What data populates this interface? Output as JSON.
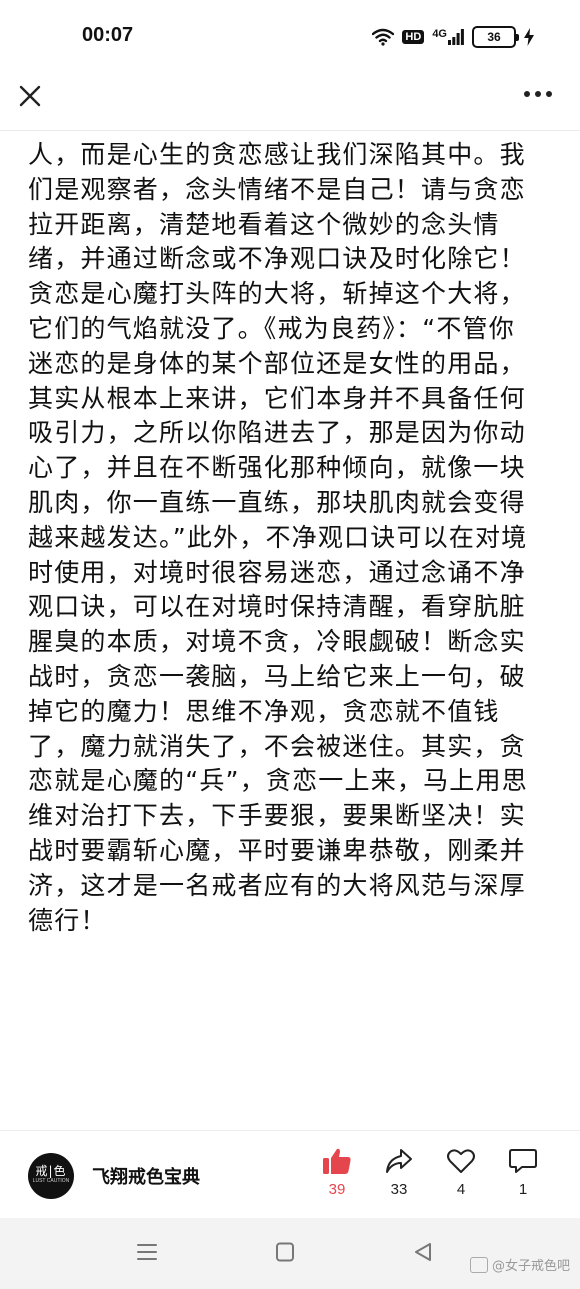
{
  "status_bar": {
    "time": "00:07",
    "hd": "HD",
    "network": "4G",
    "battery": "36",
    "icons": [
      "wifi-icon",
      "signal-icon",
      "battery-icon",
      "charging-icon"
    ]
  },
  "top_bar": {
    "close_icon": "close-icon",
    "more_icon": "more-icon"
  },
  "article": {
    "lines": [
      "人，而是心生的贪恋感让我们深陷其中。我",
      "们是观察者，念头情绪不是自己！请与贪恋",
      "拉开距离，清楚地看着这个微妙的念头情",
      "绪，并通过断念或不净观口诀及时化除它！",
      "贪恋是心魔打头阵的大将，斩掉这个大将，",
      "它们的气焰就没了。《戒为良药》：“不管你",
      "迷恋的是身体的某个部位还是女性的用品，",
      "其实从根本上来讲，它们本身并不具备任何",
      "吸引力，之所以你陷进去了，那是因为你动",
      "心了，并且在不断强化那种倾向，就像一块",
      "肌肉，你一直练一直练，那块肌肉就会变得",
      "越来越发达。”此外，不净观口诀可以在对境",
      "时使用，对境时很容易迷恋，通过念诵不净",
      "观口诀，可以在对境时保持清醒，看穿肮脏",
      "腥臭的本质，对境不贪，冷眼觑破！断念实",
      "战时，贪恋一袭脑，马上给它来上一句，破",
      "掉它的魔力！思维不净观，贪恋就不值钱",
      "了，魔力就消失了，不会被迷住。其实，贪",
      "恋就是心魔的“兵”，贪恋一上来，马上用思",
      "维对治打下去，下手要狠，要果断坚决！实",
      "战时要霸斩心魔，平时要谦卑恭敬，刚柔并",
      "济，这才是一名戒者应有的大将风范与深厚",
      "德行！"
    ]
  },
  "author": {
    "avatar_logo": "戒|色",
    "avatar_sub": "LUST CAUTION",
    "name": "飞翔戒色宝典"
  },
  "actions": {
    "like_count": "39",
    "share_count": "33",
    "favorite_count": "4",
    "comment_count": "1",
    "like_color": "#e5454d"
  },
  "nav": {
    "watermark": "@女子戒色吧"
  }
}
